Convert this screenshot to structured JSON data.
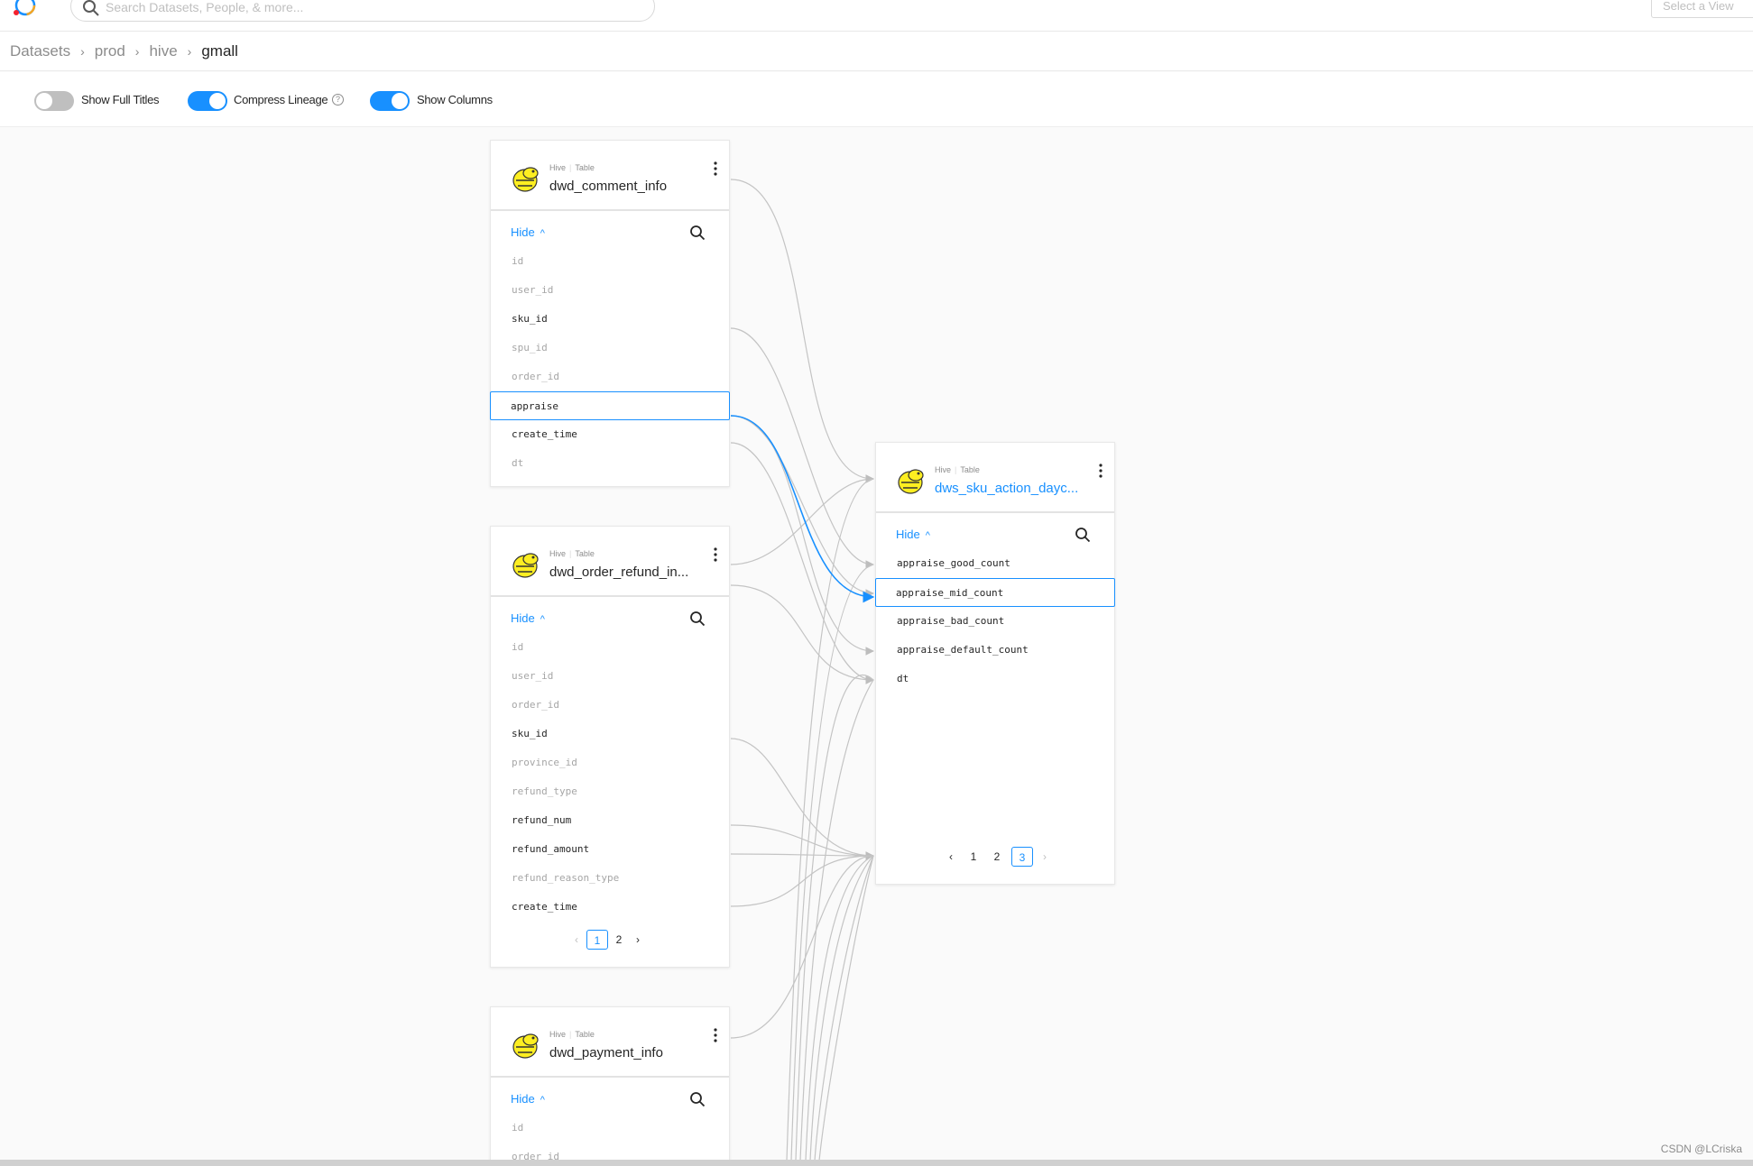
{
  "app": {
    "search_placeholder": "Search Datasets, People, & more...",
    "view_select": "Select a View"
  },
  "breadcrumb": [
    "Datasets",
    "prod",
    "hive",
    "gmall"
  ],
  "toolbar": {
    "toggles": [
      {
        "label": "Show Full Titles",
        "on": false
      },
      {
        "label": "Compress Lineage",
        "on": true
      },
      {
        "label": "Show Columns",
        "on": true
      }
    ]
  },
  "nodes": [
    {
      "platform": "Hive",
      "type": "Table",
      "name": "dwd_comment_info",
      "hide_label": "Hide",
      "columns": [
        {
          "name": "id",
          "dim": true
        },
        {
          "name": "user_id",
          "dim": true
        },
        {
          "name": "sku_id",
          "dim": false
        },
        {
          "name": "spu_id",
          "dim": true
        },
        {
          "name": "order_id",
          "dim": true
        },
        {
          "name": "appraise",
          "dim": false,
          "selected": true
        },
        {
          "name": "create_time",
          "dim": false
        },
        {
          "name": "dt",
          "dim": true
        }
      ],
      "pagination": null
    },
    {
      "platform": "Hive",
      "type": "Table",
      "name": "dwd_order_refund_in...",
      "hide_label": "Hide",
      "columns": [
        {
          "name": "id",
          "dim": true
        },
        {
          "name": "user_id",
          "dim": true
        },
        {
          "name": "order_id",
          "dim": true
        },
        {
          "name": "sku_id",
          "dim": false
        },
        {
          "name": "province_id",
          "dim": true
        },
        {
          "name": "refund_type",
          "dim": true
        },
        {
          "name": "refund_num",
          "dim": false
        },
        {
          "name": "refund_amount",
          "dim": false
        },
        {
          "name": "refund_reason_type",
          "dim": true
        },
        {
          "name": "create_time",
          "dim": false
        }
      ],
      "pagination": {
        "pages": [
          "1",
          "2"
        ],
        "current": "1"
      }
    },
    {
      "platform": "Hive",
      "type": "Table",
      "name": "dwd_payment_info",
      "hide_label": "Hide",
      "columns": [
        {
          "name": "id",
          "dim": true
        },
        {
          "name": "order_id",
          "dim": true
        }
      ],
      "pagination": null
    },
    {
      "platform": "Hive",
      "type": "Table",
      "name": "dws_sku_action_dayc...",
      "hide_label": "Hide",
      "columns": [
        {
          "name": "appraise_good_count",
          "dim": false
        },
        {
          "name": "appraise_mid_count",
          "dim": false,
          "selected": true
        },
        {
          "name": "appraise_bad_count",
          "dim": false
        },
        {
          "name": "appraise_default_count",
          "dim": false
        },
        {
          "name": "dt",
          "dim": false
        }
      ],
      "pagination": {
        "pages": [
          "1",
          "2",
          "3"
        ],
        "current": "3"
      }
    }
  ],
  "watermark": "CSDN @LCriska",
  "colors": {
    "accent": "#1890ff",
    "edge": "#c4c4c4",
    "muted": "#a6a6a6"
  },
  "icons": [
    "logo-icon",
    "search-icon",
    "help-icon",
    "hive-icon",
    "more-icon",
    "chevron-up-icon",
    "chevron-left-icon",
    "chevron-right-icon"
  ]
}
